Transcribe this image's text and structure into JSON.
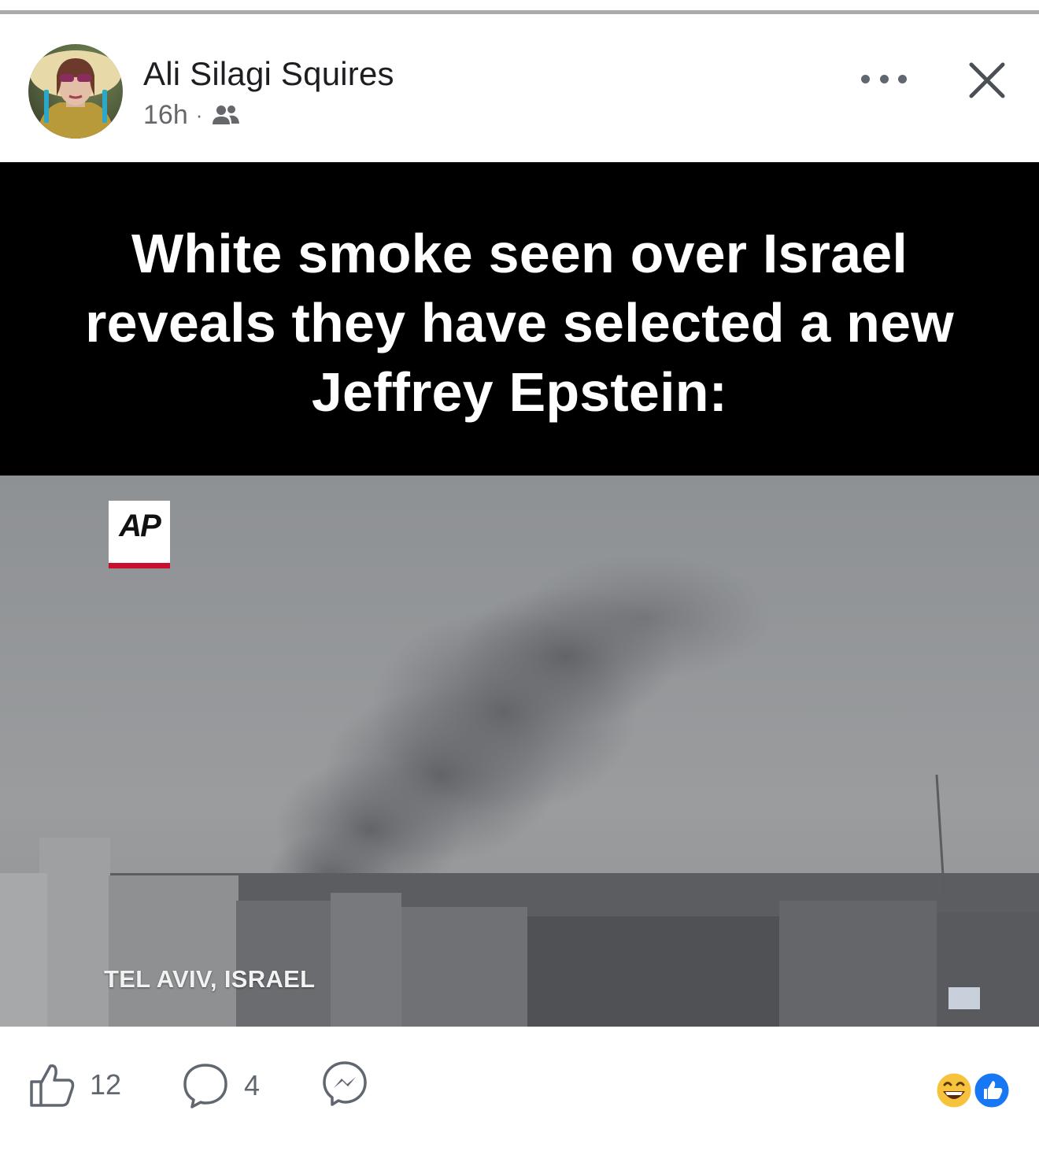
{
  "post": {
    "author": "Ali Silagi Squires",
    "time": "16h",
    "separator": "·",
    "audience_icon": "friends-icon",
    "more_icon": "more-horizontal-icon",
    "close_icon": "close-icon"
  },
  "media": {
    "caption": "White smoke seen over Israel reveals they have selected a new Jeffrey Epstein:",
    "logo": "AP",
    "location": "TEL AVIV, ISRAEL"
  },
  "actions": {
    "like_count": "12",
    "comment_count": "4",
    "like_icon": "thumbs-up-icon",
    "comment_icon": "comment-bubble-icon",
    "share_icon": "messenger-icon",
    "reaction_icons": [
      "laughing-face-icon",
      "like-badge-icon"
    ]
  },
  "colors": {
    "text_primary": "#1c1e21",
    "text_secondary": "#65676b",
    "like_blue": "#1877f2",
    "ap_red": "#c8102e"
  }
}
